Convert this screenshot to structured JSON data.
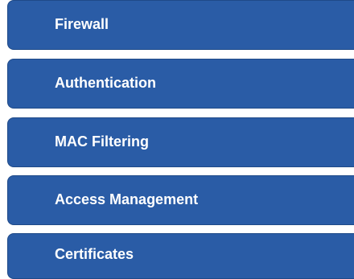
{
  "sidebar": {
    "accent_color": "#2a5ca6",
    "items": [
      {
        "label": "Firewall"
      },
      {
        "label": "Authentication"
      },
      {
        "label": "MAC Filtering"
      },
      {
        "label": "Access Management"
      },
      {
        "label": "Certificates"
      }
    ]
  }
}
